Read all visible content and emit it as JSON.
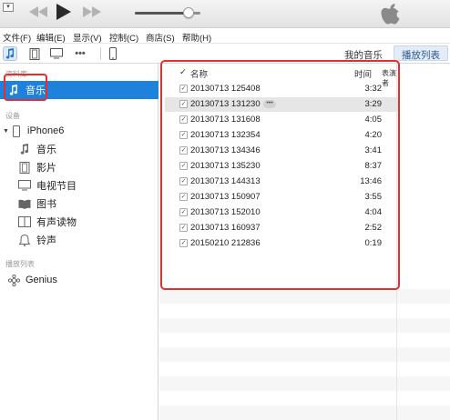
{
  "player": {
    "app_menu_icon": "window-menu-icon",
    "volume_level": 0.82
  },
  "menubar": {
    "items": [
      "文件(F)",
      "编辑(E)",
      "显示(V)",
      "控制(C)",
      "商店(S)",
      "帮助(H)"
    ]
  },
  "toolbar": {
    "tab_my_music": "我的音乐",
    "tab_playlists": "播放列表",
    "more_label": "•••"
  },
  "sidebar": {
    "library_title": "资料库",
    "library_items": [
      {
        "label": "音乐",
        "icon": "music-note-icon"
      }
    ],
    "device_title": "设备",
    "device_name": "iPhone6",
    "device_items": [
      {
        "label": "音乐",
        "icon": "music-note-icon"
      },
      {
        "label": "影片",
        "icon": "film-icon"
      },
      {
        "label": "电视节目",
        "icon": "tv-icon"
      },
      {
        "label": "图书",
        "icon": "book-icon"
      },
      {
        "label": "有声读物",
        "icon": "audiobook-icon"
      },
      {
        "label": "铃声",
        "icon": "bell-icon"
      }
    ],
    "playlist_title": "播放列表",
    "playlist_items": [
      {
        "label": "Genius",
        "icon": "genius-icon"
      }
    ]
  },
  "table": {
    "col_check": "✓",
    "col_name": "名称",
    "col_time": "时间",
    "col_artist": "表演者",
    "more_glyph": "•••",
    "check_glyph": "✓",
    "rows": [
      {
        "name": "20130713 125408",
        "time": "3:32"
      },
      {
        "name": "20130713 131230",
        "time": "3:29"
      },
      {
        "name": "20130713 131608",
        "time": "4:05"
      },
      {
        "name": "20130713 132354",
        "time": "4:20"
      },
      {
        "name": "20130713 134346",
        "time": "3:41"
      },
      {
        "name": "20130713 135230",
        "time": "8:37"
      },
      {
        "name": "20130713 144313",
        "time": "13:46"
      },
      {
        "name": "20130713 150907",
        "time": "3:55"
      },
      {
        "name": "20130713 152010",
        "time": "4:04"
      },
      {
        "name": "20130713 160937",
        "time": "2:52"
      },
      {
        "name": "20150210 212836",
        "time": "0:19"
      }
    ]
  },
  "colors": {
    "selection": "#1e82dc",
    "highlight_frame": "#e03131",
    "accent_tab": "#2c5b95"
  }
}
